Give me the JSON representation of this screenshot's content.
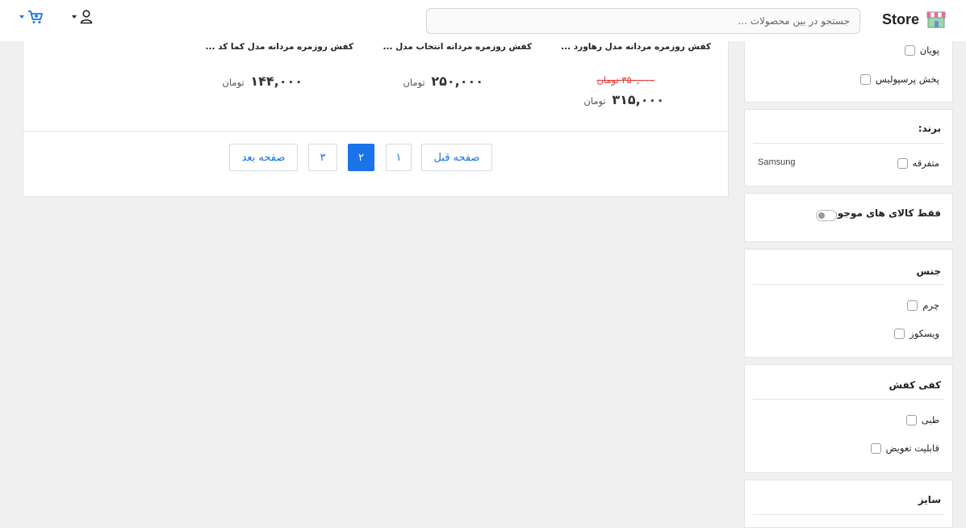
{
  "header": {
    "brand": "Store",
    "search_placeholder": "جستجو در بین محصولات ..."
  },
  "products": [
    {
      "title": "کفش روزمره مردانه مدل رهاورد ...",
      "old_price": "۳۵۰,۰۰۰ تومان",
      "price": "۳۱۵,۰۰۰",
      "currency": "تومان"
    },
    {
      "title": "کفش روزمره مردانه انتخاب مدل ...",
      "price": "۲۵۰,۰۰۰",
      "currency": "تومان"
    },
    {
      "title": "کفش روزمره مردانه مدل کما کد ...",
      "price": "۱۴۴,۰۰۰",
      "currency": "تومان"
    }
  ],
  "pagination": {
    "prev": "صفحه قبل",
    "pages": [
      "۱",
      "۲",
      "۳"
    ],
    "active_page": "۲",
    "next": "صفحه بعد"
  },
  "sidebar": {
    "top_card": {
      "options": [
        "پویان",
        "پخش پرسپولیس"
      ]
    },
    "brand_card": {
      "title": "برند:",
      "options": [
        "متفرقه"
      ],
      "side_label": "Samsung"
    },
    "stock_card": {
      "label": "فقط کالای های موجود :",
      "enabled": false
    },
    "material_card": {
      "title": "جنس",
      "options": [
        "چرم",
        "ویسکوز"
      ]
    },
    "insole_card": {
      "title": "کفی کفش",
      "options": [
        "طبی",
        "قابلیت تعویض"
      ]
    },
    "size_card": {
      "title": "سایز"
    }
  },
  "colors": {
    "accent": "#1a73e8",
    "old_price": "#e53935"
  }
}
